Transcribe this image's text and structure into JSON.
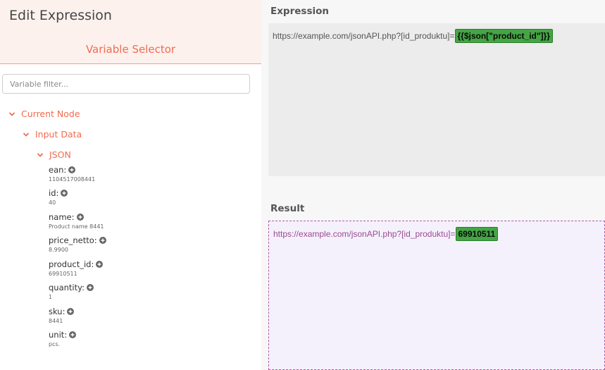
{
  "dialog": {
    "title": "Edit Expression"
  },
  "variable_selector": {
    "title": "Variable Selector",
    "filter_placeholder": "Variable filter...",
    "tree": {
      "current_node": "Current Node",
      "input_data": "Input Data",
      "json": "JSON",
      "variables": [
        {
          "name": "ean:",
          "value": "1104517008441"
        },
        {
          "name": "id:",
          "value": "40"
        },
        {
          "name": "name:",
          "value": "Product name 8441"
        },
        {
          "name": "price_netto:",
          "value": "8.9900"
        },
        {
          "name": "product_id:",
          "value": "69910511"
        },
        {
          "name": "quantity:",
          "value": "1"
        },
        {
          "name": "sku:",
          "value": "8441"
        },
        {
          "name": "unit:",
          "value": "pcs."
        }
      ]
    }
  },
  "expression": {
    "label": "Expression",
    "text": "https://example.com/jsonAPI.php?[id_produktu]=",
    "highlight": "{{$json[\"product_id\"]}}"
  },
  "result": {
    "label": "Result",
    "text": "https://example.com/jsonAPI.php?[id_produktu]=",
    "highlight": "69910511"
  },
  "colors": {
    "accent": "#f26b50",
    "highlight": "#44a544",
    "result_text": "#9c4b8e"
  }
}
